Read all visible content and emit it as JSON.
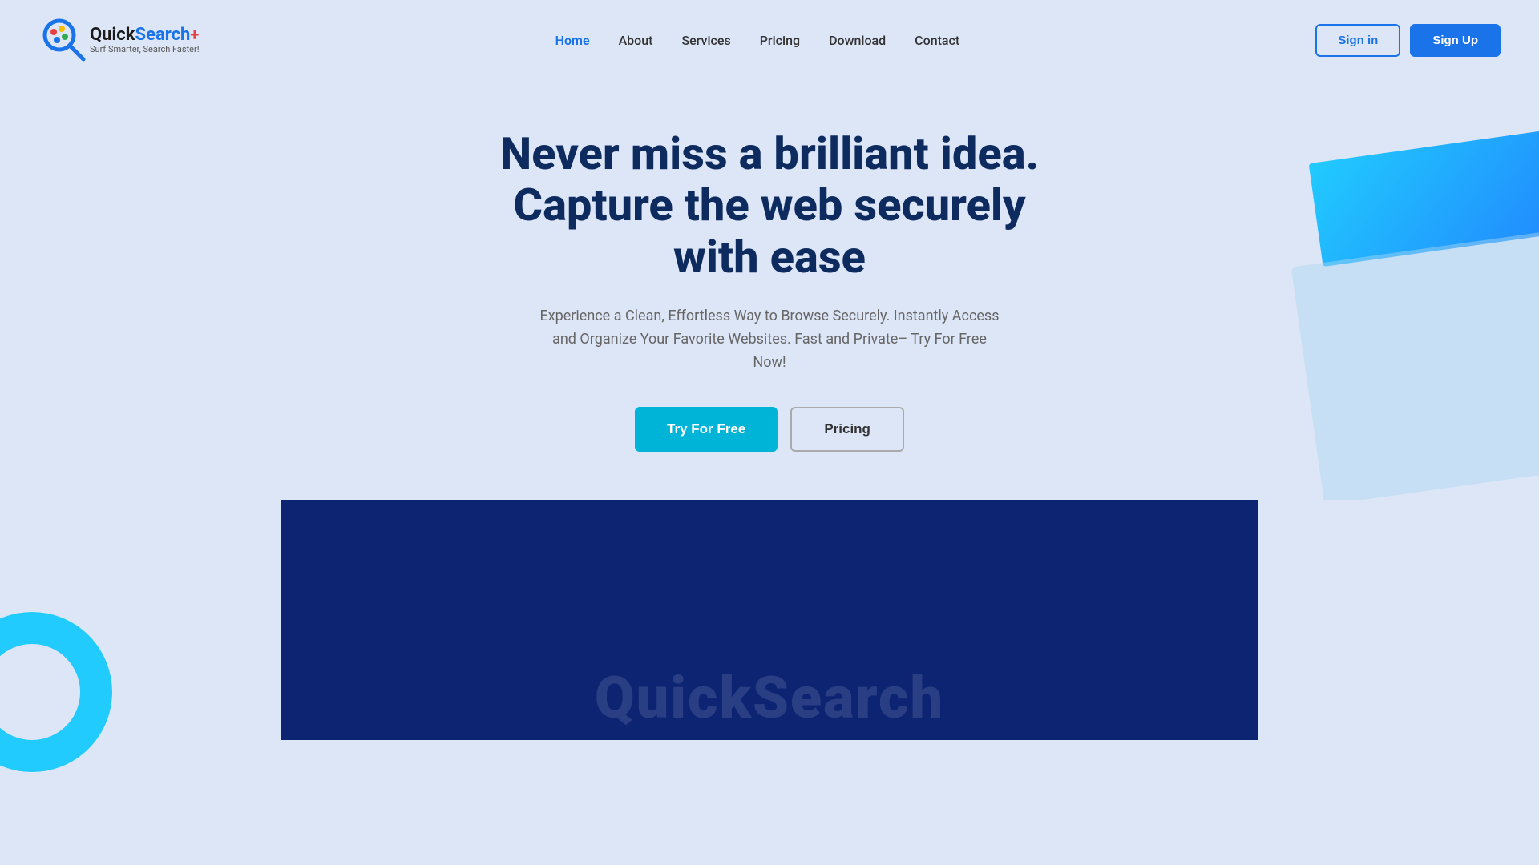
{
  "logo": {
    "title_quick": "Quick",
    "title_search": "Search",
    "title_plus": "+",
    "subtitle": "Surf Smarter, Search Faster!"
  },
  "nav": {
    "links": [
      {
        "label": "Home",
        "active": true
      },
      {
        "label": "About",
        "active": false
      },
      {
        "label": "Services",
        "active": false
      },
      {
        "label": "Pricing",
        "active": false
      },
      {
        "label": "Download",
        "active": false
      },
      {
        "label": "Contact",
        "active": false
      }
    ],
    "signin_label": "Sign in",
    "signup_label": "Sign Up"
  },
  "hero": {
    "title_line1": "Never miss a brilliant idea.",
    "title_line2": "Capture the web securely",
    "title_line3": "with ease",
    "subtitle": "Experience a Clean, Effortless Way to Browse Securely. Instantly Access and Organize Your Favorite Websites. Fast and Private– Try For Free Now!",
    "btn_try_free": "Try For Free",
    "btn_pricing": "Pricing"
  },
  "dark_section": {
    "watermark_text": "QuickSearch"
  }
}
